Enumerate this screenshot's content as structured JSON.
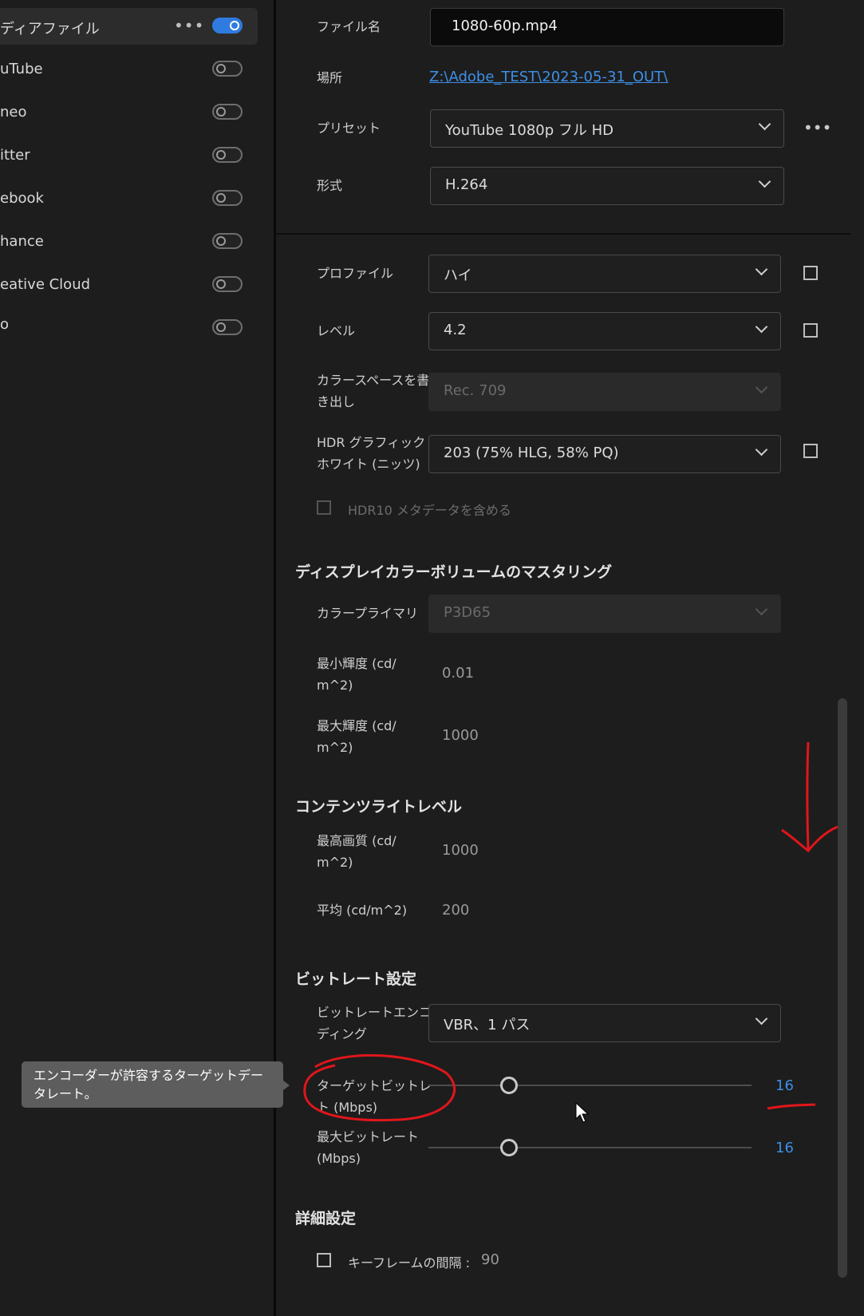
{
  "destinations": [
    {
      "label": "ディアファイル",
      "on": true,
      "menu": "•••"
    },
    {
      "label": "uTube",
      "on": false
    },
    {
      "label": "neo",
      "on": false
    },
    {
      "label": "itter",
      "on": false
    },
    {
      "label": "ebook",
      "on": false
    },
    {
      "label": "hance",
      "on": false
    },
    {
      "label": "eative Cloud",
      "on": false
    },
    {
      "label": "o",
      "on": false
    }
  ],
  "output": {
    "filename_label": "ファイル名",
    "filename_value": "1080-60p.mp4",
    "location_label": "場所",
    "location_value": "Z:\\Adobe_TEST\\2023-05-31_OUT\\",
    "preset_label": "プリセット",
    "preset_value": "YouTube 1080p フル HD",
    "preset_menu": "•••",
    "format_label": "形式",
    "format_value": "H.264"
  },
  "video": {
    "profile_label": "プロファイル",
    "profile_value": "ハイ",
    "level_label": "レベル",
    "level_value": "4.2",
    "colorspace_label_1": "カラースペースを書",
    "colorspace_label_2": "き出し",
    "colorspace_value": "Rec. 709",
    "hdr_label_1": "HDR グラフィック",
    "hdr_label_2": "ホワイト (ニッツ)",
    "hdr_value": "203 (75% HLG, 58% PQ)",
    "hdr10_label": "HDR10 メタデータを含める"
  },
  "mastering": {
    "title": "ディスプレイカラーボリュームのマスタリング",
    "primary_label": "カラープライマリ",
    "primary_value": "P3D65",
    "min_label_1": "最小輝度 (cd/",
    "min_label_2": "m^2)",
    "min_value": "0.01",
    "max_label_1": "最大輝度 (cd/",
    "max_label_2": "m^2)",
    "max_value": "1000"
  },
  "content_light": {
    "title": "コンテンツライトレベル",
    "peak_label_1": "最高画質 (cd/",
    "peak_label_2": "m^2)",
    "peak_value": "1000",
    "avg_label": "平均 (cd/m^2)",
    "avg_value": "200"
  },
  "bitrate": {
    "title": "ビットレート設定",
    "encoding_label_1": "ビットレートエンコー",
    "encoding_label_2": "ディング",
    "encoding_value": "VBR、1 パス",
    "target_label_1": "ターゲットビットレー",
    "target_label_2": "ト (Mbps)",
    "target_value": "16",
    "target_level": 0.25,
    "max_label_1": "最大ビットレート",
    "max_label_2": "(Mbps)",
    "max_value": "16",
    "max_level": 0.25
  },
  "advanced": {
    "title": "詳細設定",
    "keyframe_label": "キーフレームの間隔 :",
    "keyframe_value": "90"
  },
  "tooltip": {
    "text": "エンコーダーが許容するターゲットデータレート。"
  },
  "colors": {
    "accent": "#2f7be0",
    "value_blue": "#3d8fe6",
    "annotation_red": "#e0161b"
  }
}
